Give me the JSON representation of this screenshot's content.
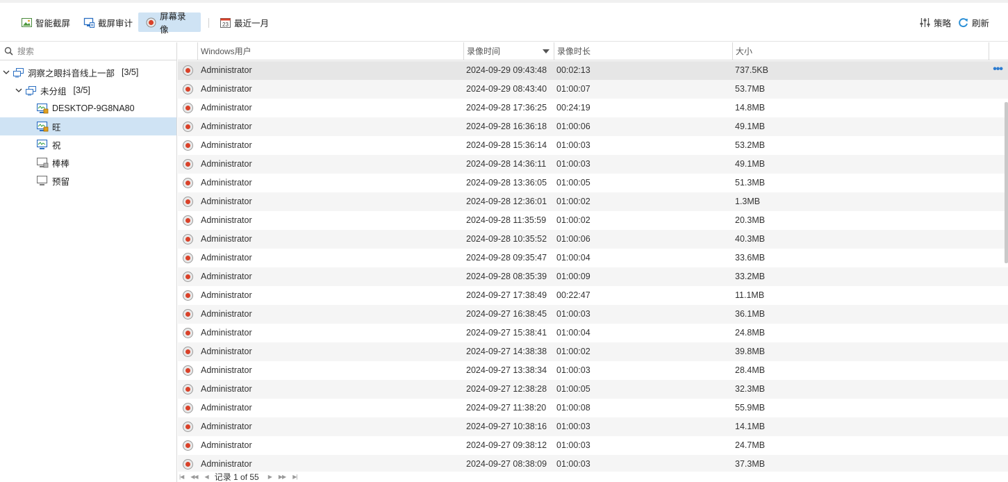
{
  "toolbar": {
    "smart_screenshot": "智能截屏",
    "screenshot_audit": "截屏审计",
    "screen_recording": "屏幕录像",
    "last_month": "最近一月",
    "calendar_day": "23",
    "strategy": "策略",
    "refresh": "刷新"
  },
  "search": {
    "placeholder": "搜索"
  },
  "tree": {
    "root": {
      "label": "洞察之眼抖音线上一部",
      "count": "[3/5]"
    },
    "group": {
      "label": "未分组",
      "count": "[3/5]"
    },
    "computers": [
      {
        "label": "DESKTOP-9G8NA80",
        "status": "online-locked"
      },
      {
        "label": "旺",
        "status": "online-locked"
      },
      {
        "label": "祝",
        "status": "online"
      },
      {
        "label": "棒棒",
        "status": "offline-locked"
      },
      {
        "label": "预留",
        "status": "offline"
      }
    ]
  },
  "grid": {
    "columns": [
      "Windows用户",
      "录像时间",
      "录像时长",
      "大小"
    ],
    "rows": [
      [
        "Administrator",
        "2024-09-29 09:43:48",
        "00:02:13",
        "737.5KB"
      ],
      [
        "Administrator",
        "2024-09-29 08:43:40",
        "01:00:07",
        "53.7MB"
      ],
      [
        "Administrator",
        "2024-09-28 17:36:25",
        "00:24:19",
        "14.8MB"
      ],
      [
        "Administrator",
        "2024-09-28 16:36:18",
        "01:00:06",
        "49.1MB"
      ],
      [
        "Administrator",
        "2024-09-28 15:36:14",
        "01:00:03",
        "53.2MB"
      ],
      [
        "Administrator",
        "2024-09-28 14:36:11",
        "01:00:03",
        "49.1MB"
      ],
      [
        "Administrator",
        "2024-09-28 13:36:05",
        "01:00:05",
        "51.3MB"
      ],
      [
        "Administrator",
        "2024-09-28 12:36:01",
        "01:00:02",
        "1.3MB"
      ],
      [
        "Administrator",
        "2024-09-28 11:35:59",
        "01:00:02",
        "20.3MB"
      ],
      [
        "Administrator",
        "2024-09-28 10:35:52",
        "01:00:06",
        "40.3MB"
      ],
      [
        "Administrator",
        "2024-09-28 09:35:47",
        "01:00:04",
        "33.6MB"
      ],
      [
        "Administrator",
        "2024-09-28 08:35:39",
        "01:00:09",
        "33.2MB"
      ],
      [
        "Administrator",
        "2024-09-27 17:38:49",
        "00:22:47",
        "11.1MB"
      ],
      [
        "Administrator",
        "2024-09-27 16:38:45",
        "01:00:03",
        "36.1MB"
      ],
      [
        "Administrator",
        "2024-09-27 15:38:41",
        "01:00:04",
        "24.8MB"
      ],
      [
        "Administrator",
        "2024-09-27 14:38:38",
        "01:00:02",
        "39.8MB"
      ],
      [
        "Administrator",
        "2024-09-27 13:38:34",
        "01:00:03",
        "28.4MB"
      ],
      [
        "Administrator",
        "2024-09-27 12:38:28",
        "01:00:05",
        "32.3MB"
      ],
      [
        "Administrator",
        "2024-09-27 11:38:20",
        "01:00:08",
        "55.9MB"
      ],
      [
        "Administrator",
        "2024-09-27 10:38:16",
        "01:00:03",
        "14.1MB"
      ],
      [
        "Administrator",
        "2024-09-27 09:38:12",
        "01:00:03",
        "24.7MB"
      ],
      [
        "Administrator",
        "2024-09-27 08:38:09",
        "01:00:03",
        "37.3MB"
      ]
    ],
    "more_label": "•••"
  },
  "pager": {
    "text": "记录 1 of 55"
  },
  "colors": {
    "selected": "#cfe3f4",
    "record_red": "#d94129",
    "accent": "#2b7bd0"
  }
}
